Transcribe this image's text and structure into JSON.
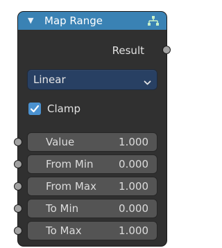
{
  "node": {
    "title": "Map Range",
    "output_label": "Result",
    "interpolation": {
      "selected": "Linear"
    },
    "clamp": {
      "label": "Clamp",
      "checked": true
    },
    "inputs": [
      {
        "label": "Value",
        "value": "1.000"
      },
      {
        "label": "From Min",
        "value": "0.000"
      },
      {
        "label": "From Max",
        "value": "1.000"
      },
      {
        "label": "To Min",
        "value": "0.000"
      },
      {
        "label": "To Max",
        "value": "1.000"
      }
    ]
  },
  "icons": {
    "collapse": "triangle-down-icon",
    "node_type": "node-tree-icon",
    "dropdown": "chevron-down-icon",
    "checkmark": "checkmark-icon"
  },
  "colors": {
    "header": "#3a82b4",
    "body": "#303030",
    "dropdown": "#284063",
    "field": "#545454",
    "socket": "#a1a1a1",
    "checkbox": "#4b92d1"
  }
}
